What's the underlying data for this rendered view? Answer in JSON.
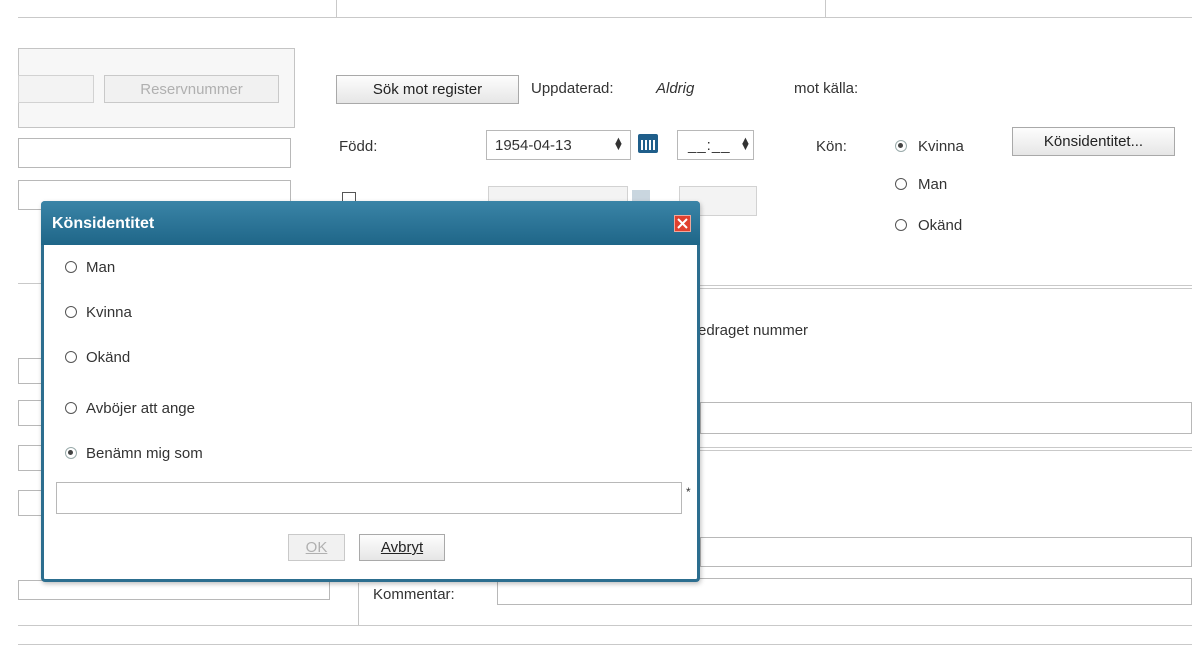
{
  "background": {
    "reserve_number_button": "Reservnummer",
    "search_register_button": "Sök mot register",
    "updated_label": "Uppdaterad:",
    "updated_value": "Aldrig",
    "source_label": "mot källa:",
    "born_label": "Född:",
    "born_date": "1954-04-13",
    "born_time": "__:__",
    "gender_label": "Kön:",
    "gender_options": [
      {
        "label": "Kvinna",
        "checked": true
      },
      {
        "label": "Man",
        "checked": false
      },
      {
        "label": "Okänd",
        "checked": false
      }
    ],
    "gender_identity_button": "Könsidentitet...",
    "partial_text": "edraget nummer",
    "comment_label": "Kommentar:",
    "disabled_time": "__:__"
  },
  "dialog": {
    "title": "Könsidentitet",
    "options": [
      {
        "label": "Man",
        "checked": false
      },
      {
        "label": "Kvinna",
        "checked": false
      },
      {
        "label": "Okänd",
        "checked": false
      },
      {
        "label": "Avböjer att ange",
        "checked": false
      },
      {
        "label": "Benämn mig som",
        "checked": true
      }
    ],
    "name_field_value": "",
    "required_marker": "*",
    "ok_button": "OK",
    "cancel_button": "Avbryt"
  },
  "colors": {
    "titlebar": "#2c6e8f",
    "close_button": "#e0402e"
  }
}
